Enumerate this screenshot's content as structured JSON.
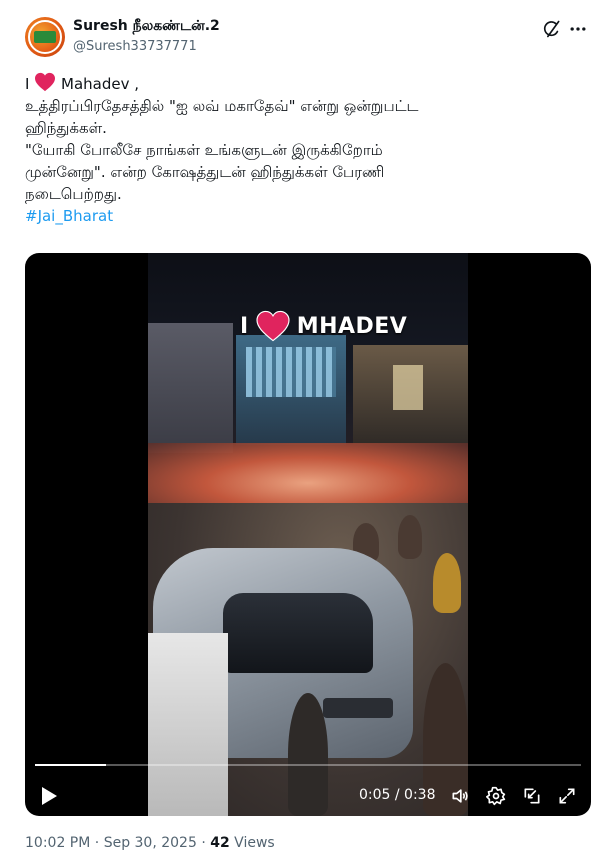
{
  "author": {
    "display_name": "Suresh நீலகண்டன்.2",
    "handle": "@Suresh33737771",
    "avatar": "avatar"
  },
  "header_icons": [
    "grok-icon",
    "more-icon"
  ],
  "tweet": {
    "line1_prefix": "I",
    "line1_suffix": "Mahadev ,",
    "line2": "உத்திரப்பிரதேசத்தில் \"ஐ லவ் மகாதேவ்\" என்று ஒன்றுபட்ட",
    "line3": "ஹிந்துக்கள்.",
    "line4": "\"யோகி போலீசே நாங்கள் உங்களுடன் இருக்கிறோம்",
    "line5": "முன்னேறு\". என்ற கோஷத்துடன் ஹிந்துக்கள் பேரணி",
    "line6": "நடைபெற்றது.",
    "hashtag": "#Jai_Bharat"
  },
  "video": {
    "overlay_prefix": "I",
    "overlay_text": "MHADEV",
    "time_display": "0:05 / 0:38",
    "progress": 0.13
  },
  "colors": {
    "accent": "#1d9bf0",
    "heart": "#e0245e"
  },
  "footer": {
    "time": "10:02 PM",
    "separator": "·",
    "date": "Sep 30, 2025",
    "views_count": "42",
    "views_label": "Views"
  }
}
